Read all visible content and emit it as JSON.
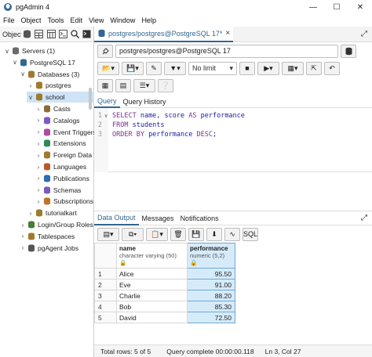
{
  "window": {
    "title": "pgAdmin 4"
  },
  "menu": [
    "File",
    "Object",
    "Tools",
    "Edit",
    "View",
    "Window",
    "Help"
  ],
  "browser": {
    "panel_label": "Object",
    "tree": [
      {
        "label": "Servers (1)",
        "depth": 0,
        "chev": "v",
        "icon": "servers-icon"
      },
      {
        "label": "PostgreSQL 17",
        "depth": 1,
        "chev": "v",
        "icon": "elephant-icon"
      },
      {
        "label": "Databases (3)",
        "depth": 2,
        "chev": "v",
        "icon": "databases-icon"
      },
      {
        "label": "postgres",
        "depth": 3,
        "chev": ">",
        "icon": "database-icon"
      },
      {
        "label": "school",
        "depth": 3,
        "chev": "v",
        "icon": "database-icon",
        "selected": true
      },
      {
        "label": "Casts",
        "depth": 4,
        "chev": ">",
        "icon": "casts-icon"
      },
      {
        "label": "Catalogs",
        "depth": 4,
        "chev": ">",
        "icon": "catalogs-icon"
      },
      {
        "label": "Event Triggers",
        "depth": 4,
        "chev": ">",
        "icon": "event-triggers-icon"
      },
      {
        "label": "Extensions",
        "depth": 4,
        "chev": ">",
        "icon": "extensions-icon"
      },
      {
        "label": "Foreign Data W",
        "depth": 4,
        "chev": ">",
        "icon": "foreign-data-icon"
      },
      {
        "label": "Languages",
        "depth": 4,
        "chev": ">",
        "icon": "languages-icon"
      },
      {
        "label": "Publications",
        "depth": 4,
        "chev": ">",
        "icon": "publications-icon"
      },
      {
        "label": "Schemas",
        "depth": 4,
        "chev": ">",
        "icon": "schemas-icon"
      },
      {
        "label": "Subscriptions",
        "depth": 4,
        "chev": ">",
        "icon": "subscriptions-icon"
      },
      {
        "label": "tutorialkart",
        "depth": 3,
        "chev": ">",
        "icon": "database-icon"
      },
      {
        "label": "Login/Group Roles",
        "depth": 2,
        "chev": ">",
        "icon": "roles-icon"
      },
      {
        "label": "Tablespaces",
        "depth": 2,
        "chev": ">",
        "icon": "tablespaces-icon"
      },
      {
        "label": "pgAgent Jobs",
        "depth": 2,
        "chev": ">",
        "icon": "jobs-icon"
      }
    ]
  },
  "editor_tab": {
    "label": "postgres/postgres@PostgreSQL 17*"
  },
  "toolbar": {
    "connection": "postgres/postgres@PostgreSQL 17",
    "limit": "No limit"
  },
  "query_tabs": [
    "Query",
    "Query History"
  ],
  "sql_lines": [
    {
      "n": "1",
      "parts": [
        [
          "kw",
          "SELECT "
        ],
        [
          "tx",
          "name, score "
        ],
        [
          "kw",
          "AS "
        ],
        [
          "tx",
          "performance"
        ]
      ]
    },
    {
      "n": "2",
      "parts": [
        [
          "kw",
          "FROM "
        ],
        [
          "tx",
          "students"
        ]
      ]
    },
    {
      "n": "3",
      "parts": [
        [
          "kw",
          "ORDER BY "
        ],
        [
          "tx",
          "performance "
        ],
        [
          "kw",
          "DESC"
        ],
        [
          "tx",
          ";"
        ]
      ]
    }
  ],
  "output_tabs": [
    "Data Output",
    "Messages",
    "Notifications"
  ],
  "output_toolbar": {
    "sql_label": "SQL"
  },
  "grid": {
    "columns": [
      {
        "name": "name",
        "type": "character varying (50)"
      },
      {
        "name": "performance",
        "type": "numeric (5,2)"
      }
    ],
    "rows": [
      {
        "n": "1",
        "name": "Alice",
        "performance": "95.50"
      },
      {
        "n": "2",
        "name": "Eve",
        "performance": "91.00"
      },
      {
        "n": "3",
        "name": "Charlie",
        "performance": "88.20"
      },
      {
        "n": "4",
        "name": "Bob",
        "performance": "85.30"
      },
      {
        "n": "5",
        "name": "David",
        "performance": "72.50"
      }
    ]
  },
  "status": {
    "total_rows": "Total rows: 5 of 5",
    "query_complete": "Query complete 00:00:00.118",
    "position": "Ln 3, Col 27"
  },
  "colors": {
    "accent": "#326690",
    "selection": "#cfe3f6",
    "highlight_column": "#d6ebf9"
  }
}
